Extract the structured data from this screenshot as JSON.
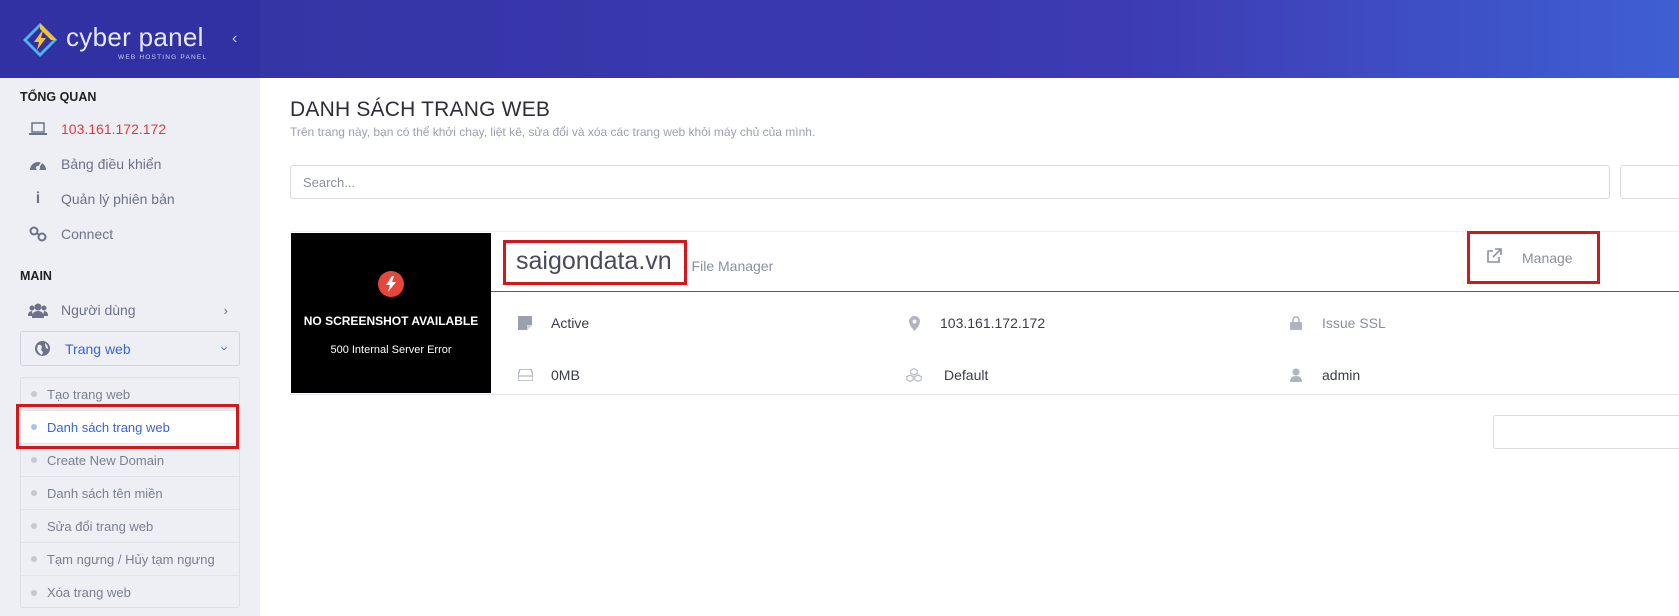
{
  "brand": {
    "name": "cyber panel",
    "tagline": "WEB HOSTING PANEL"
  },
  "sidebar": {
    "overview_heading": "TỔNG QUAN",
    "overview_items": [
      {
        "label": "103.161.172.172",
        "icon": "laptop-icon"
      },
      {
        "label": "Bảng điều khiển",
        "icon": "dashboard-icon"
      },
      {
        "label": "Quản lý phiên bản",
        "icon": "info-icon"
      },
      {
        "label": "Connect",
        "icon": "link-icon"
      }
    ],
    "main_heading": "MAIN",
    "main_items": [
      {
        "label": "Người dùng",
        "icon": "users-icon"
      },
      {
        "label": "Trang web",
        "icon": "globe-icon"
      }
    ],
    "websites_submenu": [
      "Tạo trang web",
      "Danh sách trang web",
      "Create New Domain",
      "Danh sách tên miền",
      "Sửa đổi trang web",
      "Tạm ngưng / Hủy tạm ngưng",
      "Xóa trang web"
    ],
    "active_submenu": "Danh sách trang web"
  },
  "page": {
    "title": "DANH SÁCH TRANG WEB",
    "subtitle": "Trên trang này, bạn có thể khởi chạy, liệt kê, sửa đổi và xóa các trang web khỏi máy chủ của mình."
  },
  "search": {
    "placeholder": "Search..."
  },
  "website": {
    "screenshot_title": "NO SCREENSHOT AVAILABLE",
    "screenshot_error": "500 Internal Server Error",
    "domain": "saigondata.vn",
    "file_manager_label": "- File Manager",
    "manage_label": "Manage",
    "status": "Active",
    "ip": "103.161.172.172",
    "ssl_label": "Issue SSL",
    "disk_usage": "0MB",
    "package": "Default",
    "owner": "admin"
  },
  "colors": {
    "header": "#3131a4",
    "accent": "#3b63d9",
    "ip_highlight": "#e23a3a",
    "annotation_box": "#d3181a"
  }
}
